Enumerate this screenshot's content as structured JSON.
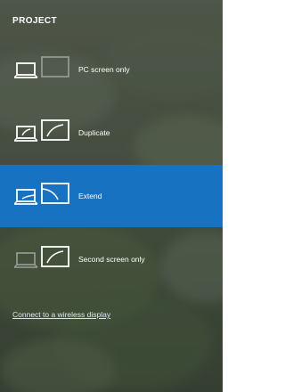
{
  "panel": {
    "title": "PROJECT"
  },
  "options": [
    {
      "label": "PC screen only",
      "icon": "pc-screen-only-icon"
    },
    {
      "label": "Duplicate",
      "icon": "duplicate-icon"
    },
    {
      "label": "Extend",
      "icon": "extend-icon"
    },
    {
      "label": "Second screen only",
      "icon": "second-screen-only-icon"
    }
  ],
  "selected_option": "Extend",
  "wireless_link": "Connect to a wireless display",
  "colors": {
    "accent": "#1872c2",
    "text": "#ffffff"
  }
}
